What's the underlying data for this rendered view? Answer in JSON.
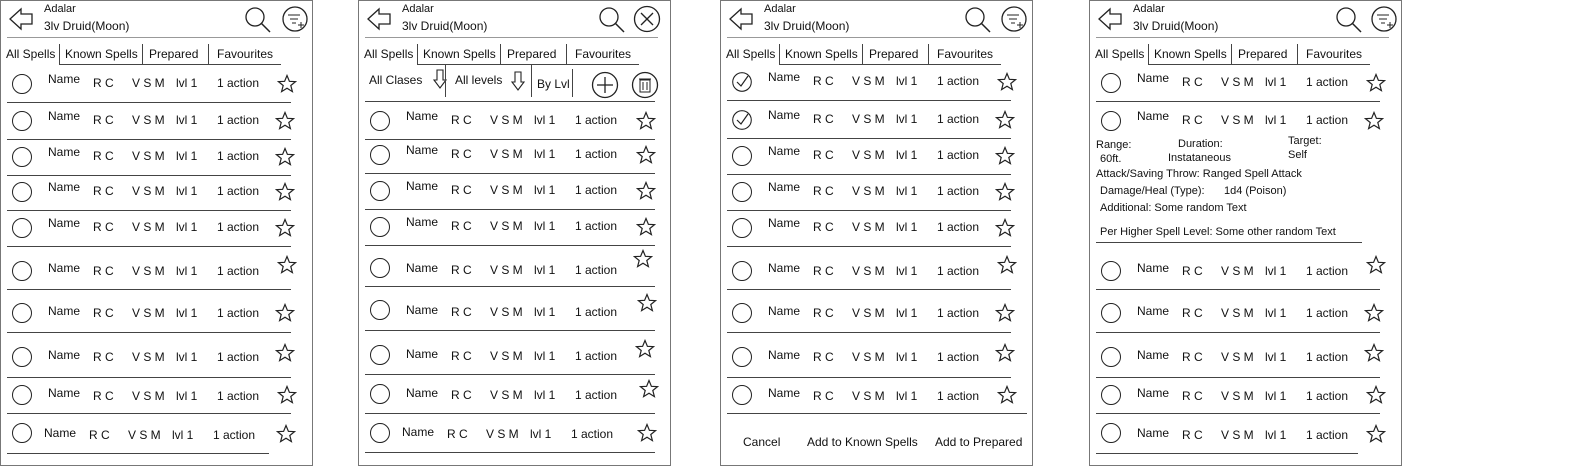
{
  "header": {
    "character_name": "Adalar",
    "character_class": "3lv Druid(Moon)"
  },
  "tabs": [
    "All Spells",
    "Known Spells",
    "Prepared",
    "Favourites"
  ],
  "spell_row": {
    "name": "Name",
    "range_cost": "R C",
    "components": "V S M",
    "level": "lvl 1",
    "cast_time": "1 action"
  },
  "filters": {
    "classes": "All Clases",
    "levels": "All levels",
    "sort": "By Lvl"
  },
  "selection_footer": {
    "cancel": "Cancel",
    "add_known": "Add to Known Spells",
    "add_prepared": "Add to Prepared"
  },
  "expanded_spell": {
    "range_label": "Range:",
    "range_value": "60ft.",
    "duration_label": "Duration:",
    "duration_value": "Instataneous",
    "target_label": "Target:",
    "target_value": "Self",
    "attack_line": "Attack/Saving Throw: Ranged Spell Attack",
    "damage_label": "Damage/Heal (Type):",
    "damage_value": "1d4 (Poison)",
    "additional": "Additional: Some random Text",
    "higher_level": "Per Higher Spell Level: Some other random Text"
  },
  "icons": {
    "back": "back-arrow-icon",
    "search": "search-icon",
    "filter_add": "filter-add-icon",
    "close": "close-icon",
    "add": "add-icon",
    "delete": "trash-icon",
    "favourite": "star-outline-icon",
    "select": "radio-icon",
    "selected": "radio-checked-icon"
  }
}
